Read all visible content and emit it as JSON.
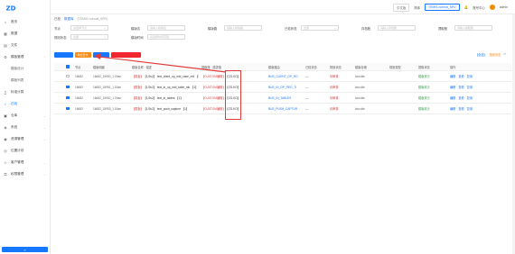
{
  "logo": {
    "name": "zd-logo-icon"
  },
  "sidebar": {
    "items": [
      {
        "label": "首页",
        "icon": "home-icon"
      },
      {
        "label": "数据",
        "icon": "grid-icon"
      },
      {
        "label": "文件",
        "icon": "file-icon"
      },
      {
        "label": "模板管理",
        "icon": "settings-icon",
        "chevron": "⌃"
      },
      {
        "label": "模板设计",
        "sub": true
      },
      {
        "label": "模板列表",
        "sub": true
      },
      {
        "label": "标准计算",
        "icon": "calc-icon"
      },
      {
        "label": "已检",
        "icon": "check-icon",
        "active": true
      },
      {
        "label": "仓库",
        "icon": "warehouse-icon",
        "chevron": "⌄"
      },
      {
        "label": "系统",
        "icon": "system-icon",
        "chevron": "⌄"
      },
      {
        "label": "资源管理",
        "icon": "resource-icon",
        "chevron": "⌄"
      },
      {
        "label": "位置计划",
        "icon": "location-icon"
      },
      {
        "label": "客户管理",
        "icon": "customer-icon",
        "chevron": "⌄"
      },
      {
        "label": "权限管理",
        "icon": "lock-icon",
        "chevron": "⌄"
      }
    ],
    "collapse": "«"
  },
  "topbar": {
    "chip1": "中文版",
    "chip2": "简体",
    "chip3": "TEMIS-normal_SRV",
    "bell": "🔔",
    "user": "admin",
    "user_prefix": "账号中心"
  },
  "tabs": [
    "已检",
    "数据库",
    "(TEMIS-normal_SRV)"
  ],
  "filters": {
    "row1": [
      {
        "label": "节点",
        "placeholder": "请选择节点",
        "w": 40,
        "caret": "⌄"
      },
      {
        "label": "模版名",
        "placeholder": "请输入模版名",
        "w": 40
      },
      {
        "label": "模版路",
        "placeholder": "请输入模版路",
        "w": 40
      },
      {
        "label": "已检状态",
        "placeholder": "全部",
        "w": 40,
        "caret": "⌄"
      },
      {
        "label": "存档账",
        "placeholder": "请输入存档账",
        "w": 40
      },
      {
        "label": "提取账",
        "placeholder": "请输入提取账",
        "w": 40
      }
    ],
    "row2": [
      {
        "label": "规则状态",
        "placeholder": "全部",
        "w": 40,
        "caret": "⌄"
      },
      {
        "label": "模版时间",
        "placeholder": "请选择时间范围",
        "w": 40
      }
    ]
  },
  "toolbar": {
    "btn1": "新增模板",
    "btn1_caret": "▾",
    "btn2": "导出日志",
    "btn3": "模版命令",
    "btn4": "使用多路模板与设置",
    "right1": "【全选】",
    "right2": "搜索历史",
    "right3": "⟳"
  },
  "table": {
    "headers": [
      "",
      "节点",
      "模版明细",
      "模版名称 · 描述",
      "提取账 · 描述值",
      "模版路由",
      "已检状态",
      "规则状态",
      "模版存储",
      "规则类型",
      "提取状态",
      "操作"
    ],
    "rows": [
      {
        "checked": false,
        "node": "16682",
        "code": "16682_15950_1.00ae",
        "name_tag": "【模板】",
        "name": "【1/3v2】 text_client_op_mid_case_m6 【1】",
        "field_tag": "【CUSTOM编辑】",
        "field_val": "【CS-KO】",
        "route": "BUS_CLIENT_OP_RO",
        "state": "—",
        "rule": "待审核",
        "store": "tcircuile",
        "type": "",
        "status": "模版执行",
        "ops": [
          "编辑",
          "查看",
          "复用"
        ]
      },
      {
        "checked": true,
        "node": "16682",
        "code": "16682_15951_1.00ae",
        "name_tag": "【模板】",
        "name": "【1/3v2】 text_in_op_mid_table_mk 【1】",
        "field_tag": "【CUSTOM编辑】",
        "field_val": "【CS-KO】",
        "route": "BUS_IN_OP_REG_TI",
        "state": "—",
        "rule": "待审核",
        "store": "tcircuile",
        "type": "",
        "status": "模版执行",
        "ops": [
          "编辑",
          "查看",
          "复用"
        ]
      },
      {
        "checked": true,
        "node": "16682",
        "code": "16682_15952_1.00ae",
        "name_tag": "【模板】",
        "name": "【1/3v2】 text_in_tables 【1】",
        "field_tag": "【CUSTOM编辑】",
        "field_val": "【CS-KO】",
        "route": "BUS_IN_TABLES",
        "state": "—",
        "rule": "待审核",
        "store": "tcircuile",
        "type": "",
        "status": "模版执行",
        "ops": [
          "编辑",
          "查看",
          "复用"
        ]
      },
      {
        "checked": true,
        "node": "16682",
        "code": "16682_15953_1.00ae",
        "name_tag": "【模板】",
        "name": "【1/3v2】 text_push_capture 【1】",
        "field_tag": "【CUSTOM编辑】",
        "field_val": "【CS-KO】",
        "route": "BUS_PUSH_CAPTUR",
        "state": "—",
        "rule": "待审核",
        "store": "tcircuile",
        "type": "",
        "status": "模版执行",
        "ops": [
          "编辑",
          "查看",
          "复用"
        ]
      }
    ]
  },
  "colors": {
    "accent": "#1677ff",
    "orange": "#fa8c16",
    "red": "#f5222d",
    "annotation": "#e03b3b"
  }
}
